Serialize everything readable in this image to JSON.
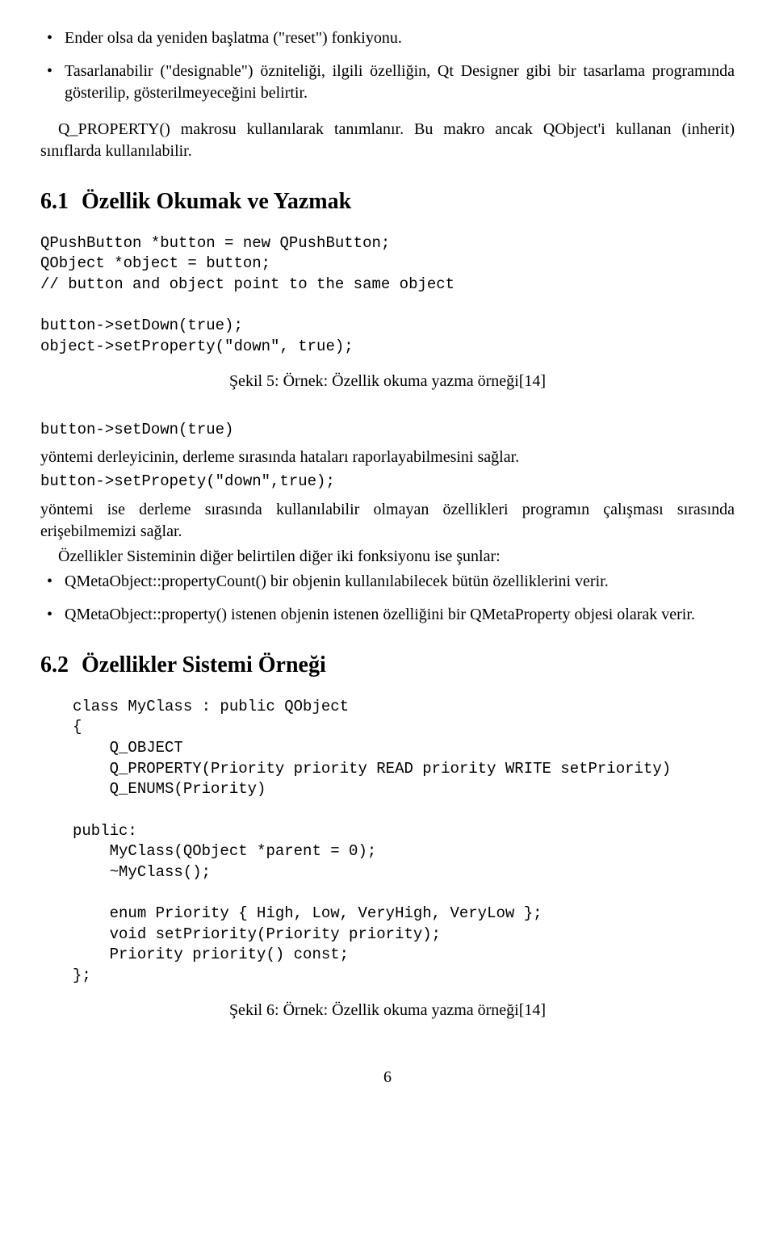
{
  "bullets_top": [
    "Ender olsa da yeniden başlatma (\"reset\") fonkiyonu.",
    "Tasarlanabilir (\"designable\") özniteliği, ilgili özelliğin, Qt Designer gibi bir tasarlama programında gösterilip, gösterilmeyeceğini belirtir."
  ],
  "para_after_bullets": "Q_PROPERTY() makrosu kullanılarak tanımlanır. Bu makro ancak QObject'i kullanan (inherit) sınıflarda kullanılabilir.",
  "sec61_num": "6.1",
  "sec61_title": "Özellik Okumak ve Yazmak",
  "code_block1": "QPushButton *button = new QPushButton;\nQObject *object = button;\n// button and object point to the same object\n\nbutton->setDown(true);\nobject->setProperty(\"down\", true);",
  "caption1": "Şekil 5: Örnek: Özellik okuma yazma örneği[14]",
  "code_line2": "button->setDown(true)",
  "para2": "yöntemi derleyicinin, derleme sırasında hataları raporlayabilmesini sağlar.",
  "code_line3": "button->setPropety(\"down\",true);",
  "para3": "yöntemi ise derleme sırasında kullanılabilir olmayan özellikleri programın çalışması sırasında erişebilmemizi sağlar.",
  "para4": "Özellikler Sisteminin diğer belirtilen diğer iki fonksiyonu ise şunlar:",
  "bullets_mid": [
    "QMetaObject::propertyCount() bir objenin kullanılabilecek bütün özelliklerini verir.",
    "QMetaObject::property() istenen objenin istenen özelliğini bir QMetaProperty objesi olarak verir."
  ],
  "sec62_num": "6.2",
  "sec62_title": "Özellikler Sistemi Örneği",
  "code_block2": "class MyClass : public QObject\n{\n    Q_OBJECT\n    Q_PROPERTY(Priority priority READ priority WRITE setPriority)\n    Q_ENUMS(Priority)\n\npublic:\n    MyClass(QObject *parent = 0);\n    ~MyClass();\n\n    enum Priority { High, Low, VeryHigh, VeryLow };\n    void setPriority(Priority priority);\n    Priority priority() const;\n};",
  "caption2": "Şekil 6: Örnek: Özellik okuma yazma örneği[14]",
  "pagenum": "6"
}
